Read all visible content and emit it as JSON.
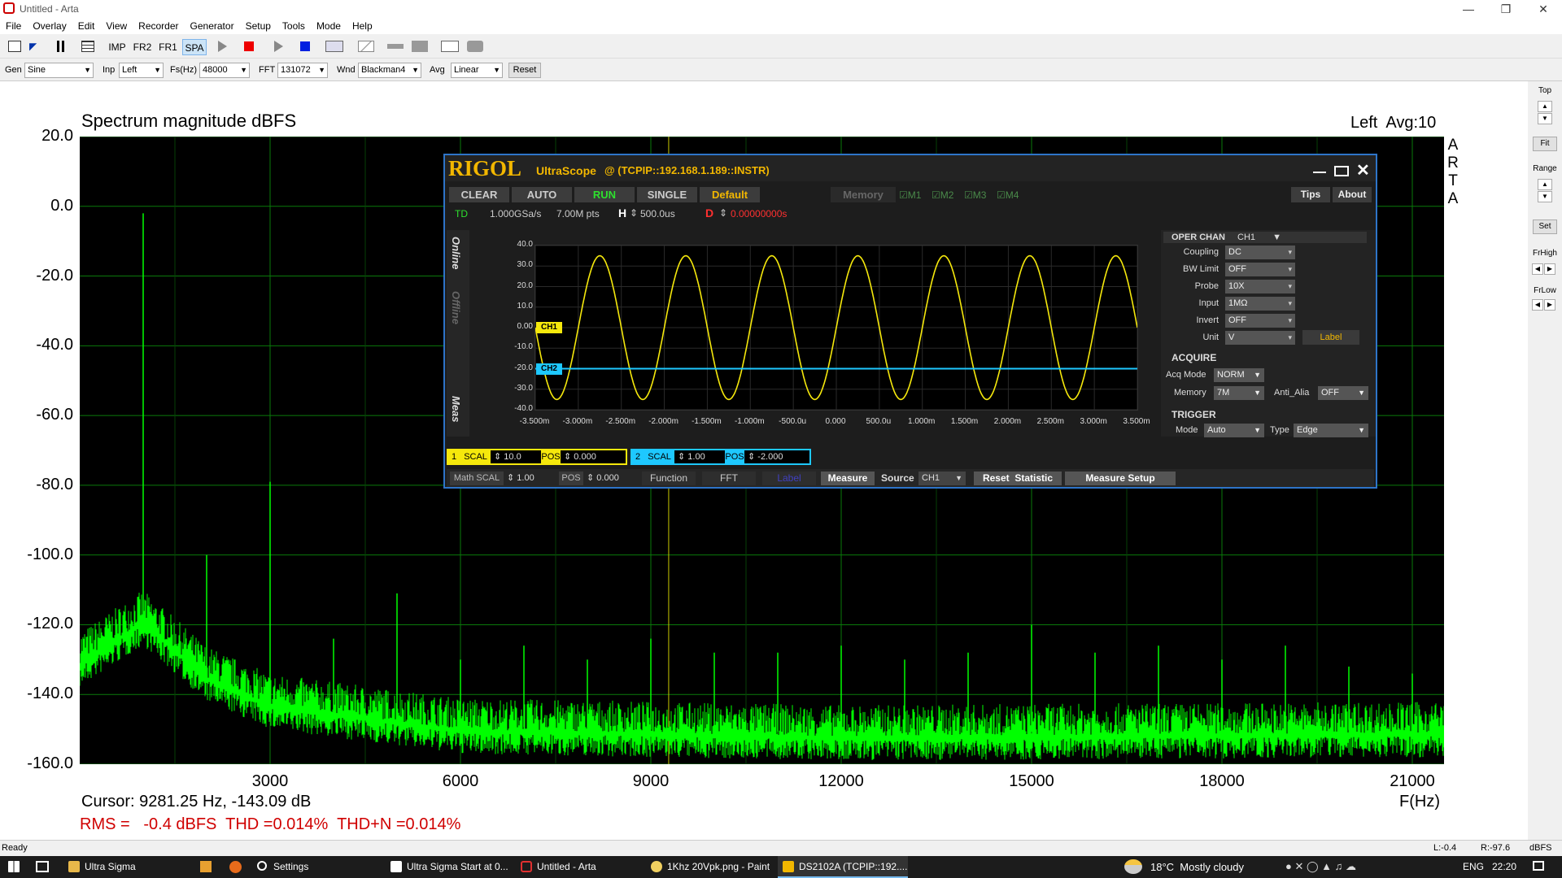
{
  "window": {
    "title": "Untitled - Arta"
  },
  "menu": [
    "File",
    "Overlay",
    "Edit",
    "View",
    "Recorder",
    "Generator",
    "Setup",
    "Tools",
    "Mode",
    "Help"
  ],
  "toolbar": {
    "imp": "IMP",
    "fr2": "FR2",
    "fr1": "FR1",
    "spa": "SPA"
  },
  "params": {
    "gen_label": "Gen",
    "gen_value": "Sine",
    "inp_label": "Inp",
    "inp_value": "Left",
    "fs_label": "Fs(Hz)",
    "fs_value": "48000",
    "fft_label": "FFT",
    "fft_value": "131072",
    "wnd_label": "Wnd",
    "wnd_value": "Blackman4",
    "avg_label": "Avg",
    "avg_value": "Linear",
    "reset": "Reset"
  },
  "plot": {
    "title": "Spectrum magnitude dBFS",
    "channel_info": "Left  Avg:10",
    "arta_mark": [
      "A",
      "R",
      "T",
      "A"
    ],
    "xunit": "F(Hz)",
    "cursor": "Cursor: 9281.25 Hz, -143.09 dB",
    "rms": "RMS =   -0.4 dBFS  THD =0.014%  THD+N =0.014%"
  },
  "chart_data": {
    "type": "line",
    "title": "Spectrum magnitude dBFS",
    "xlabel": "F(Hz)",
    "ylabel": "",
    "xlim": [
      0,
      21500
    ],
    "ylim": [
      -160,
      20
    ],
    "yticks": [
      "20.0",
      "0.0",
      "-20.0",
      "-40.0",
      "-60.0",
      "-80.0",
      "-100.0",
      "-120.0",
      "-140.0",
      "-160.0"
    ],
    "xticks": [
      "3000",
      "6000",
      "9000",
      "12000",
      "15000",
      "18000",
      "21000"
    ],
    "grid": true,
    "series": [
      {
        "name": "Left",
        "color": "#00ff00",
        "peaks": [
          {
            "x": 1000,
            "y": -2
          },
          {
            "x": 2000,
            "y": -100
          },
          {
            "x": 3000,
            "y": -79
          },
          {
            "x": 4000,
            "y": -124
          },
          {
            "x": 5000,
            "y": -111
          },
          {
            "x": 6000,
            "y": -130
          },
          {
            "x": 7000,
            "y": -126
          },
          {
            "x": 8000,
            "y": -130
          },
          {
            "x": 9000,
            "y": -124
          },
          {
            "x": 10000,
            "y": -128
          },
          {
            "x": 11000,
            "y": -128
          },
          {
            "x": 12000,
            "y": -126
          },
          {
            "x": 13000,
            "y": -130
          },
          {
            "x": 14000,
            "y": -128
          },
          {
            "x": 15000,
            "y": -120
          },
          {
            "x": 16000,
            "y": -128
          },
          {
            "x": 17000,
            "y": -126
          },
          {
            "x": 18000,
            "y": -130
          },
          {
            "x": 19000,
            "y": -126
          },
          {
            "x": 20000,
            "y": -132
          },
          {
            "x": 21000,
            "y": -134
          }
        ],
        "noise_floor": [
          {
            "x": 0,
            "y": -130
          },
          {
            "x": 1000,
            "y": -118
          },
          {
            "x": 2000,
            "y": -134
          },
          {
            "x": 3000,
            "y": -142
          },
          {
            "x": 6000,
            "y": -149
          },
          {
            "x": 12000,
            "y": -151
          },
          {
            "x": 21500,
            "y": -150
          }
        ]
      }
    ]
  },
  "scope": {
    "brand": "RIGOL",
    "product": "UltraScope",
    "address": "@ (TCPIP::192.168.1.189::INSTR)",
    "buttons": {
      "clear": "CLEAR",
      "auto": "AUTO",
      "run": "RUN",
      "single": "SINGLE",
      "default": "Default"
    },
    "memory": "Memory",
    "mems": [
      "M1",
      "M2",
      "M3",
      "M4"
    ],
    "tips": "Tips",
    "about": "About",
    "td": "TD",
    "rate": "1.000GSa/s",
    "pts": "7.00M pts",
    "h": "H",
    "hval": "500.0us",
    "d": "D",
    "dval": "0.00000000s",
    "tabs": {
      "online": "Online",
      "offline": "Offline",
      "meas": "Meas"
    },
    "yticks": [
      "40.0",
      "30.0",
      "20.0",
      "10.0",
      "0.00",
      "-10.0",
      "-20.0",
      "-30.0",
      "-40.0"
    ],
    "xticks": [
      "-3.500m",
      "-3.000m",
      "-2.500m",
      "-2.000m",
      "-1.500m",
      "-1.000m",
      "-500.0u",
      "0.000",
      "500.0u",
      "1.000m",
      "1.500m",
      "2.000m",
      "2.500m",
      "3.000m",
      "3.500m"
    ],
    "ch1": "CH1",
    "ch2": "CH2",
    "ch1_color": "#f5e80c",
    "ch2_color": "#1ec8ff",
    "oper_chan": "OPER CHAN",
    "oper_val": "CH1",
    "rows": [
      {
        "label": "Coupling",
        "value": "DC"
      },
      {
        "label": "BW Limit",
        "value": "OFF"
      },
      {
        "label": "Probe",
        "value": "10X"
      },
      {
        "label": "Input",
        "value": "1MΩ"
      },
      {
        "label": "Invert",
        "value": "OFF"
      },
      {
        "label": "Unit",
        "value": "V"
      }
    ],
    "label_btn": "Label",
    "acquire": "ACQUIRE",
    "acq_mode_l": "Acq Mode",
    "acq_mode_v": "NORM",
    "memory_l": "Memory",
    "memory_v": "7M",
    "anti_l": "Anti_Alia",
    "anti_v": "OFF",
    "trigger": "TRIGGER",
    "mode_l": "Mode",
    "mode_v": "Auto",
    "type_l": "Type",
    "type_v": "Edge",
    "ch1_bar": {
      "num": "1",
      "scal": "SCAL",
      "scal_v": "10.0",
      "pos": "POS",
      "pos_v": "0.000"
    },
    "ch2_bar": {
      "num": "2",
      "scal": "SCAL",
      "scal_v": "1.00",
      "pos": "POS",
      "pos_v": "-2.000"
    },
    "math": {
      "scal": "Math SCAL",
      "scal_v": "1.00",
      "pos": "POS",
      "pos_v": "0.000",
      "function": "Function",
      "fft": "FFT",
      "label": "Label"
    },
    "measure": "Measure",
    "source": "Source",
    "source_v": "CH1",
    "reset_stat": "Reset  Statistic",
    "meas_setup": "Measure Setup",
    "chart_data": {
      "type": "line",
      "xlim": [
        -3.5,
        3.5
      ],
      "ylim": [
        -40,
        40
      ],
      "series": [
        {
          "name": "CH1",
          "amplitude": 35,
          "frequency_khz": 1,
          "offset": 0
        },
        {
          "name": "CH2",
          "values_const": -20
        }
      ]
    }
  },
  "right": {
    "top": "Top",
    "fit": "Fit",
    "range": "Range",
    "set": "Set",
    "frhigh": "FrHigh",
    "frlow": "FrLow"
  },
  "status": {
    "ready": "Ready",
    "l": "L:-0.4",
    "r": "R:-97.6",
    "unit": "dBFS"
  },
  "taskbar": {
    "items": [
      "Ultra Sigma",
      "Settings",
      "Ultra Sigma Start at 0...",
      "Untitled - Arta",
      "1Khz 20Vpk.png - Paint",
      "DS2102A (TCPIP::192...."
    ],
    "weather": "18°C  Mostly cloudy",
    "lang": "ENG",
    "time": "22:20"
  }
}
